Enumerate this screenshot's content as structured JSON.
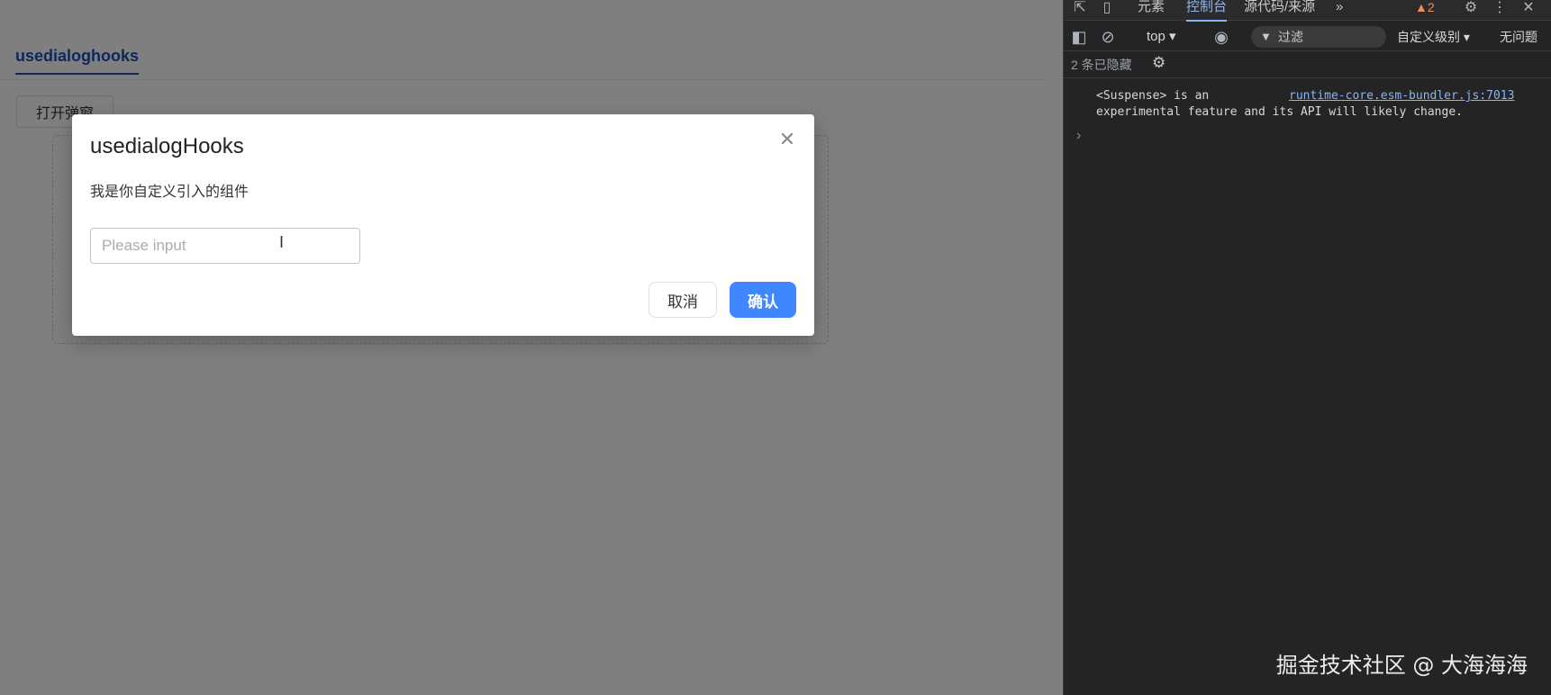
{
  "app": {
    "tab_label": "usedialoghooks",
    "open_button_label": "打开弹窗"
  },
  "dialog": {
    "title": "usedialogHooks",
    "body_text": "我是你自定义引入的组件",
    "input_placeholder": "Please input",
    "input_value": "",
    "cancel_label": "取消",
    "confirm_label": "确认",
    "close_icon": "close-icon"
  },
  "devtools": {
    "tabs": [
      {
        "label": "元素",
        "active": false
      },
      {
        "label": "控制台",
        "active": true
      },
      {
        "label": "源代码/来源",
        "active": false
      }
    ],
    "more_tabs_label": "»",
    "warning_count": "2",
    "context_label": "top ▾",
    "filter_placeholder": "过滤",
    "level_label": "自定义级别 ▾",
    "issues_label": "无问题",
    "hidden_count_label": "2 条已隐藏",
    "message_text_line1": "<Suspense> is an",
    "message_text_line2": "experimental feature and its API will likely change.",
    "message_source": "runtime-core.esm-bundler.js:7013",
    "prompt_symbol": "›"
  },
  "watermark": "掘金技术社区 @ 大海海海",
  "colors": {
    "primary": "#3f86ff",
    "tab_active": "#1f4fbf",
    "devtools_bg": "#242424",
    "link": "#8ab4f8",
    "warning": "#f28b54"
  }
}
